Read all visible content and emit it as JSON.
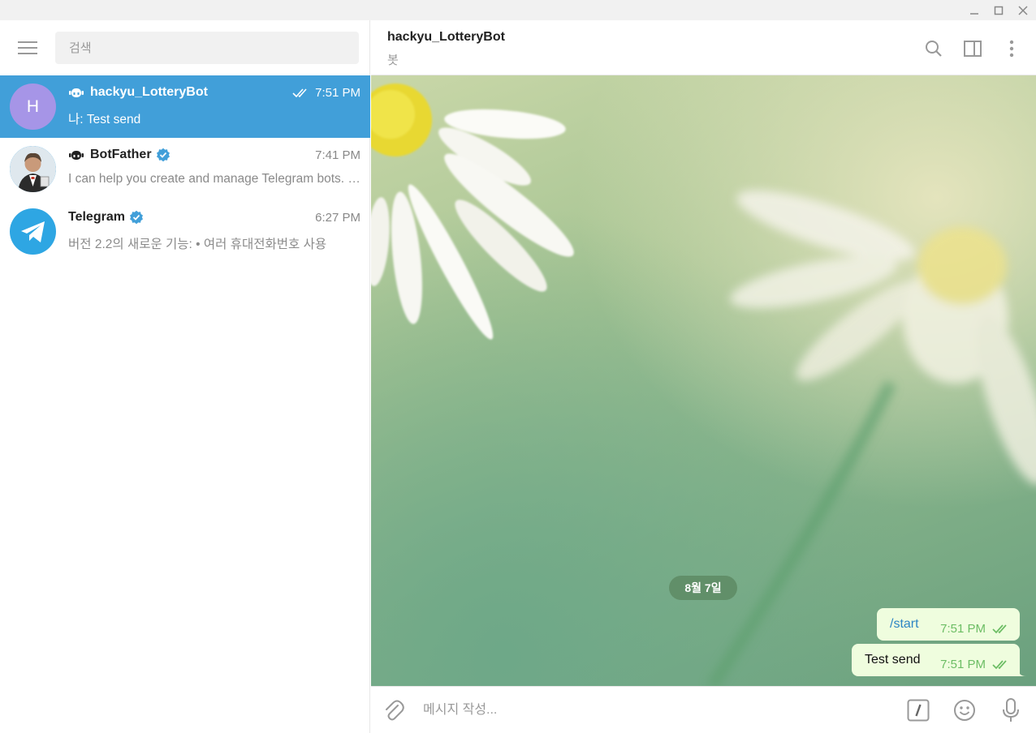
{
  "sidebar": {
    "search_placeholder": "검색",
    "chats": [
      {
        "name": "hackyu_LotteryBot",
        "time": "7:51 PM",
        "preview": "나: Test send",
        "avatar_letter": "H",
        "avatar_color": "#a695e7",
        "active": true,
        "bot": true,
        "verified": false,
        "read": true
      },
      {
        "name": "BotFather",
        "time": "7:41 PM",
        "preview": "I can help you create and manage Telegram bots. If you're new to the Bot API, please see the manual",
        "bot": true,
        "verified": true
      },
      {
        "name": "Telegram",
        "time": "6:27 PM",
        "preview": "버전 2.2의 새로운 기능: • 여러 휴대전화번호 사용",
        "verified": true
      }
    ]
  },
  "header": {
    "title": "hackyu_LotteryBot",
    "subtitle": "봇"
  },
  "conversation": {
    "date_label": "8월 7일",
    "messages": [
      {
        "text": "/start",
        "time": "7:51 PM",
        "is_command": true
      },
      {
        "text": "Test send",
        "time": "7:51 PM",
        "is_command": false
      }
    ]
  },
  "composer": {
    "placeholder": "메시지 작성..."
  },
  "colors": {
    "accent": "#419fd9",
    "bubble_out": "#effdde",
    "check": "#6cbd64",
    "command_link": "#2e85c4"
  }
}
